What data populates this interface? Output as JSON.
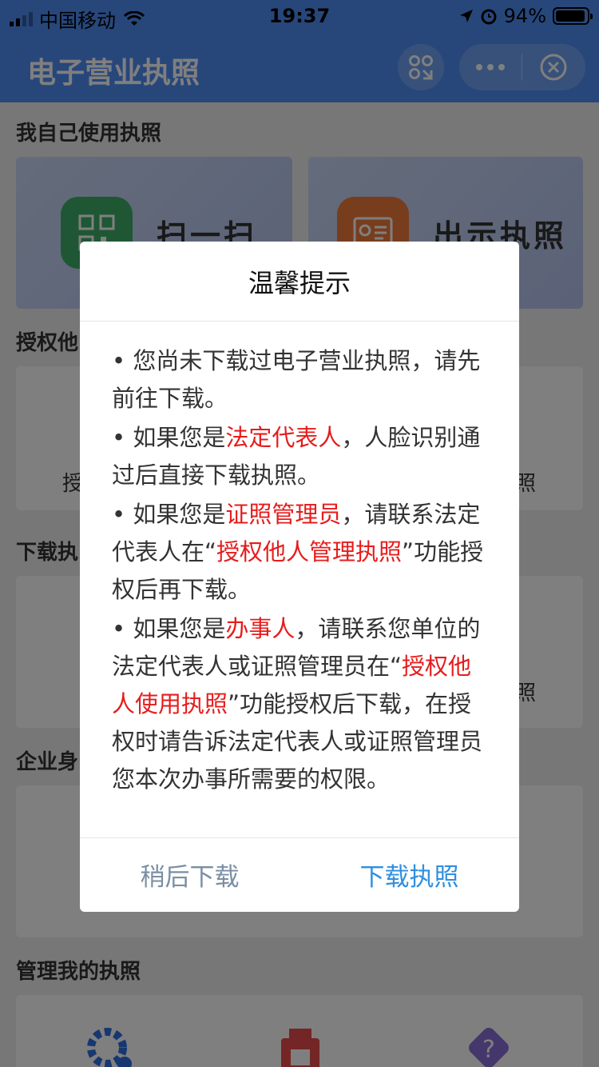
{
  "status_bar": {
    "carrier": "中国移动",
    "time": "19:37",
    "battery": "94%",
    "battery_level": 0.94
  },
  "nav": {
    "title": "电子营业执照"
  },
  "background": {
    "section_own": "我自己使用执照",
    "scan_label": "扫一扫",
    "show_license_label": "出示执照",
    "section_authorize_partial": "授权他",
    "authorize_card_left_partial": "授",
    "authorize_card_right_partial": "照",
    "section_download_partial": "下载执",
    "download_card_right_partial": "照",
    "section_identity_partial": "企业身",
    "section_manage": "管理我的执照"
  },
  "dialog": {
    "title": "温馨提示",
    "tips": [
      {
        "bullet": "•",
        "parts": [
          "您尚未下载过电子营业执照，请先前往下载。"
        ]
      },
      {
        "bullet": "•",
        "before": "如果您是",
        "highlight": "法定代表人",
        "after": "，人脸识别通过后直接下载执照。"
      },
      {
        "bullet": "•",
        "before": "如果您是",
        "highlight": "证照管理员",
        "after": "，请联系法定代表人在“",
        "highlight2": "授权他人管理执照",
        "after2": "”功能授权后再下载。"
      },
      {
        "bullet": "•",
        "before": "如果您是",
        "highlight": "办事人",
        "after": "，请联系您单位的法定代表人或证照管理员在“",
        "highlight2": "授权他人使用执照",
        "after2": "”功能授权后下载，在授权时请告诉法定代表人或证照管理员您本次办事所需要的权限。"
      }
    ],
    "later_label": "稍后下载",
    "download_label": "下载执照"
  },
  "colors": {
    "nav_blue": "#4e8ff6",
    "highlight_red": "#e61c1c",
    "link_blue": "#2f8fe0"
  }
}
